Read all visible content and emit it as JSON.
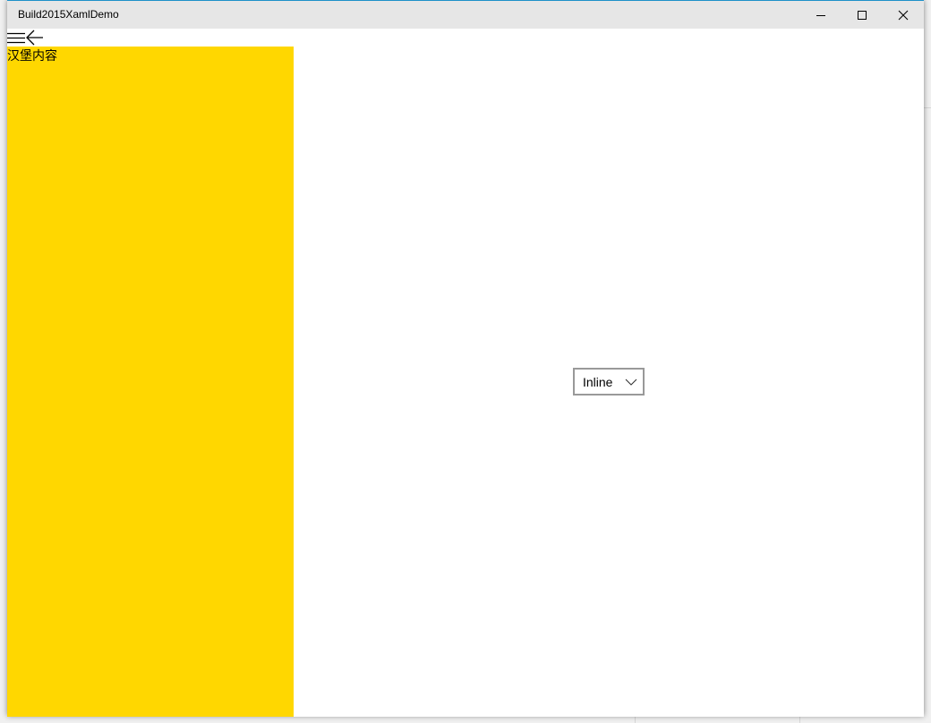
{
  "window": {
    "title": "Build2015XamlDemo"
  },
  "caption_buttons": {
    "minimize_icon": "minimize-icon",
    "maximize_icon": "maximize-icon",
    "close_icon": "close-icon"
  },
  "split_view": {
    "toggle_icon": "hamburger-menu-icon",
    "back_icon": "back-arrow-icon",
    "pane_text": "汉堡内容",
    "pane_color": "#FFD700"
  },
  "display_mode_combo": {
    "selected": "Inline",
    "chevron_icon": "chevron-down-icon"
  }
}
